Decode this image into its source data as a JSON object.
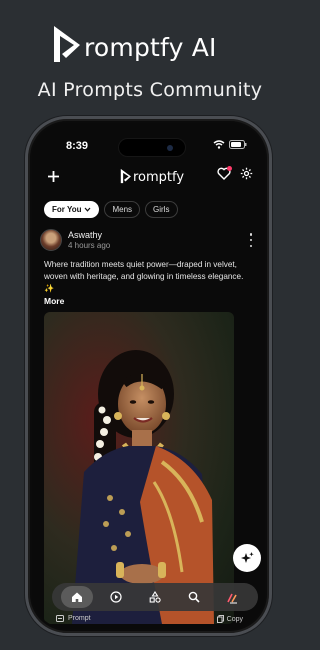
{
  "promo": {
    "brand": "romptfy AI",
    "subtitle": "AI Prompts Community"
  },
  "status": {
    "time": "8:39"
  },
  "header": {
    "brand": "romptfy"
  },
  "filters": [
    {
      "label": "For You",
      "active": true
    },
    {
      "label": "Mens",
      "active": false
    },
    {
      "label": "Girls",
      "active": false
    }
  ],
  "post": {
    "user": "Aswathy",
    "time": "4 hours ago",
    "caption": "Where tradition meets quiet power—draped in velvet, woven with heritage, and glowing in timeless elegance. ✨",
    "more": "More"
  },
  "footer": {
    "prompt_label": "Prompt",
    "copy_label": "Copy"
  },
  "colors": {
    "bg": "#2b2f33",
    "notification": "#ff3b6b"
  }
}
